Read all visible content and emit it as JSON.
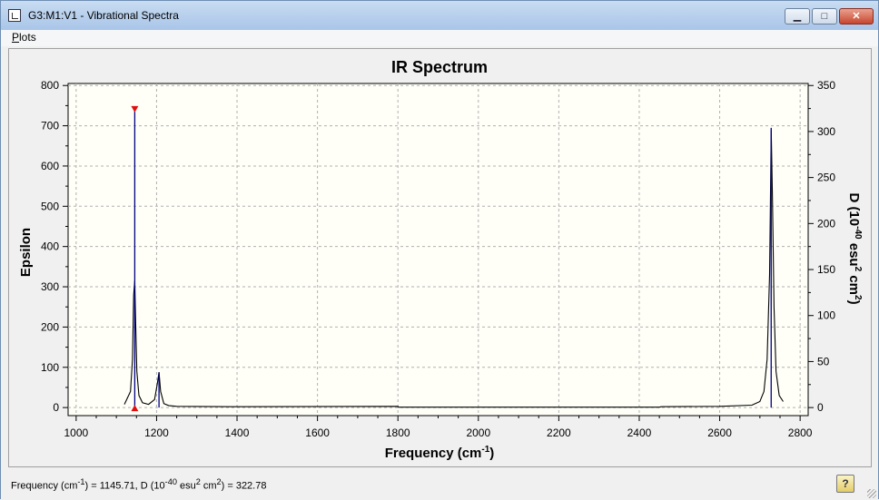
{
  "window": {
    "title": "G3:M1:V1 - Vibrational Spectra"
  },
  "controls": {
    "minimize": "▁",
    "maximize": "□",
    "close": "✕"
  },
  "menu": {
    "plots_first": "P",
    "plots_rest": "lots"
  },
  "status": {
    "frequency_readout_pre": "Frequency (cm",
    "frequency_readout_sup1": "-1",
    "frequency_readout_mid": ") = 1145.71, D (10",
    "frequency_readout_sup2": "-40",
    "frequency_readout_mid2": " esu",
    "frequency_readout_sup3": "2",
    "frequency_readout_mid3": " cm",
    "frequency_readout_sup4": "2",
    "frequency_readout_post": ") = 322.78",
    "help_label": "?"
  },
  "chart_data": {
    "type": "line",
    "title": "IR Spectrum",
    "xlabel": "Frequency (cm-1)",
    "xlabel_main": "Frequency (cm",
    "xlabel_sup": "-1",
    "xlabel_close": ")",
    "ylabel_left": "Epsilon",
    "ylabel_right_parts": [
      "D (10",
      "-40",
      " esu",
      "2",
      " cm",
      "2",
      ")"
    ],
    "xlim": [
      980,
      2820
    ],
    "ylim_left": [
      -20,
      805
    ],
    "ylim_right": [
      -8.75,
      352.2
    ],
    "x_ticks": [
      1000,
      1200,
      1400,
      1600,
      1800,
      2000,
      2200,
      2400,
      2600,
      2800
    ],
    "y_ticks_left": [
      0,
      100,
      200,
      300,
      400,
      500,
      600,
      700,
      800
    ],
    "y_ticks_right": [
      0,
      50,
      100,
      150,
      200,
      250,
      300,
      350
    ],
    "grid": true,
    "colors": {
      "curve": "#000000",
      "sticks": "#00007f",
      "marker": "#e01010",
      "plot_bg": "#fffff8",
      "grid": "#b0b0b0"
    },
    "spectrum": {
      "name": "Epsilon",
      "x": [
        1120,
        1135,
        1140,
        1143,
        1145.7,
        1148,
        1151,
        1156,
        1165,
        1180,
        1195,
        1202,
        1206,
        1210,
        1218,
        1230,
        1250,
        1400,
        1800,
        1801,
        2450,
        2455,
        2600,
        2680,
        2700,
        2710,
        2718,
        2724,
        2728,
        2731,
        2735,
        2740,
        2748,
        2758
      ],
      "y": [
        8,
        40,
        120,
        280,
        315,
        210,
        90,
        30,
        12,
        8,
        20,
        60,
        88,
        40,
        10,
        5,
        3,
        2,
        3,
        1,
        1,
        2,
        3,
        6,
        15,
        40,
        120,
        330,
        690,
        530,
        250,
        90,
        30,
        15
      ]
    },
    "sticks": {
      "name": "D",
      "x": [
        1145.71,
        1206,
        2728
      ],
      "y_right": [
        322.78,
        38,
        304
      ]
    },
    "selected_marker": {
      "x": 1145.71,
      "y_right": 322.78
    }
  }
}
